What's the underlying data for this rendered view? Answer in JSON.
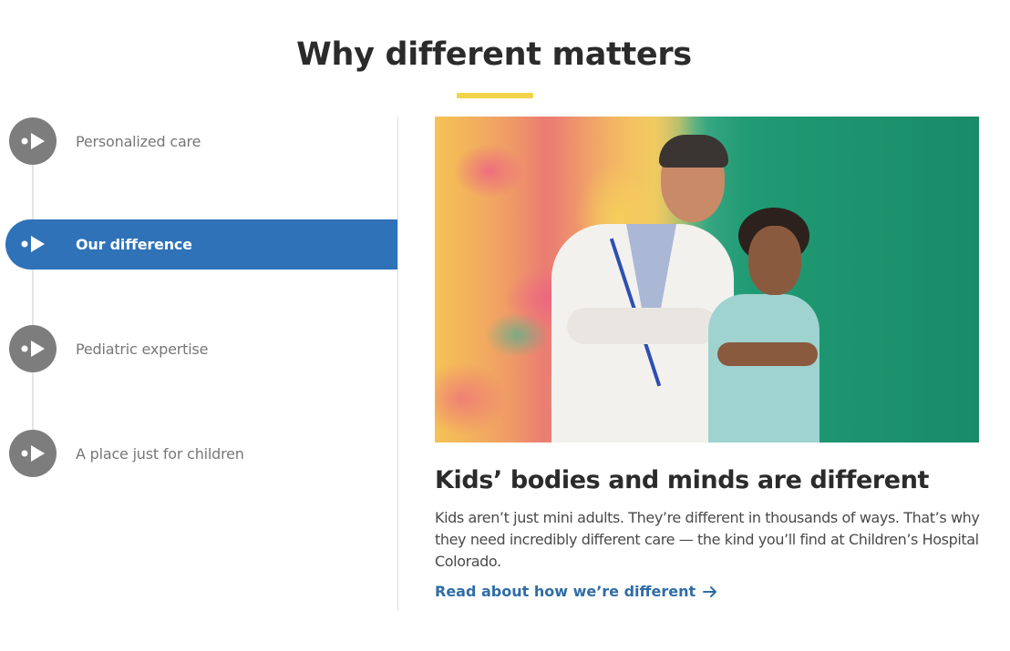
{
  "section": {
    "title": "Why different matters",
    "accent_color": "#f2d34a"
  },
  "nav": {
    "active_color": "#2f72b8",
    "items": [
      {
        "label": "Personalized care",
        "active": false,
        "icon": "play-circle-icon"
      },
      {
        "label": "Our difference",
        "active": true,
        "icon": "play-circle-icon"
      },
      {
        "label": "Pediatric expertise",
        "active": false,
        "icon": "play-circle-icon"
      },
      {
        "label": "A place just for children",
        "active": false,
        "icon": "play-circle-icon"
      }
    ]
  },
  "content": {
    "headline": "Kids’ bodies and minds are different",
    "body": "Kids aren’t just mini adults. They’re different in thousands of ways. That’s why they need incredibly different care — the kind you’ll find at Children’s Hospital Colorado.",
    "link_label": "Read about how we’re different",
    "link_icon": "arrow-right-icon",
    "link_color": "#2f6da6"
  }
}
